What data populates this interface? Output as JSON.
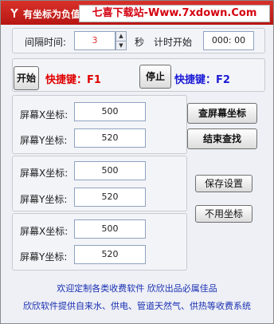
{
  "window": {
    "title": "有坐标为负值",
    "banner": "七喜下载站-Www.7xdown.Com"
  },
  "interval": {
    "label": "间隔时间:",
    "value": "3",
    "unit": "秒",
    "timer_label": "计时开始",
    "timer_value": "000: 00"
  },
  "hotkeys": {
    "start_button": "开始",
    "start_hotkey": "快捷键：F1",
    "start_color": "#e00000",
    "stop_button": "停止",
    "stop_hotkey": "快捷键：F2",
    "stop_color": "#1b1bd6"
  },
  "coord_groups": [
    {
      "x_label": "屏幕X坐标:",
      "x_value": "500",
      "y_label": "屏幕Y坐标:",
      "y_value": "520"
    },
    {
      "x_label": "屏幕X坐标:",
      "x_value": "500",
      "y_label": "屏幕Y坐标:",
      "y_value": "520"
    },
    {
      "x_label": "屏幕X坐标:",
      "x_value": "500",
      "y_label": "屏幕Y坐标:",
      "y_value": "520"
    }
  ],
  "actions": {
    "find_coord": "查屏幕坐标",
    "end_find": "结束查找",
    "save_settings": "保存设置",
    "no_coord": "不用坐标"
  },
  "footer": {
    "line1": "欢迎定制各类收费软件  欣欣出品必属佳品",
    "line2": "欣欣软件提供自来水、供电、管道天然气、供热等收费系统"
  }
}
